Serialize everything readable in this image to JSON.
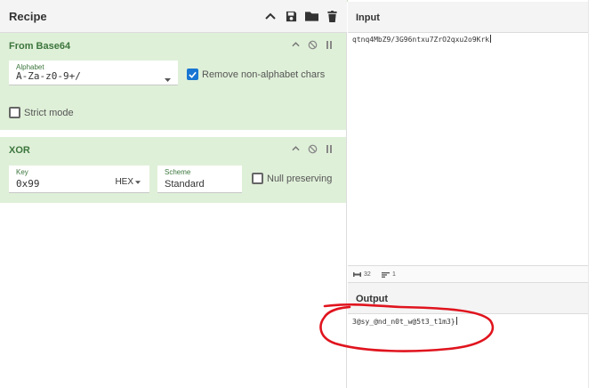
{
  "recipe": {
    "title": "Recipe",
    "header_icons": [
      "chevron-up-icon",
      "save-icon",
      "folder-icon",
      "trash-icon"
    ],
    "operations": [
      {
        "name": "From Base64",
        "alphabet_label": "Alphabet",
        "alphabet_value": "A-Za-z0-9+/",
        "remove_nonalpha_label": "Remove non-alphabet chars",
        "remove_nonalpha_checked": true,
        "strict_mode_label": "Strict mode",
        "strict_mode_checked": false
      },
      {
        "name": "XOR",
        "key_label": "Key",
        "key_value": "0x99",
        "key_format": "HEX",
        "scheme_label": "Scheme",
        "scheme_value": "Standard",
        "null_preserving_label": "Null preserving",
        "null_preserving_checked": false
      }
    ]
  },
  "input": {
    "title": "Input",
    "text": "qtnq4MbZ9/3G96ntxu7ZrO2qxu2o9Krk",
    "char_count": "32",
    "line_count": "1"
  },
  "output": {
    "title": "Output",
    "text": "3@sy_@nd_n0t_w@5t3_t1m3}"
  },
  "colors": {
    "operation_bg": "#dff0d8",
    "operation_title": "#3c763d",
    "checkbox_on": "#1976d2",
    "annotation": "#e0141e"
  }
}
